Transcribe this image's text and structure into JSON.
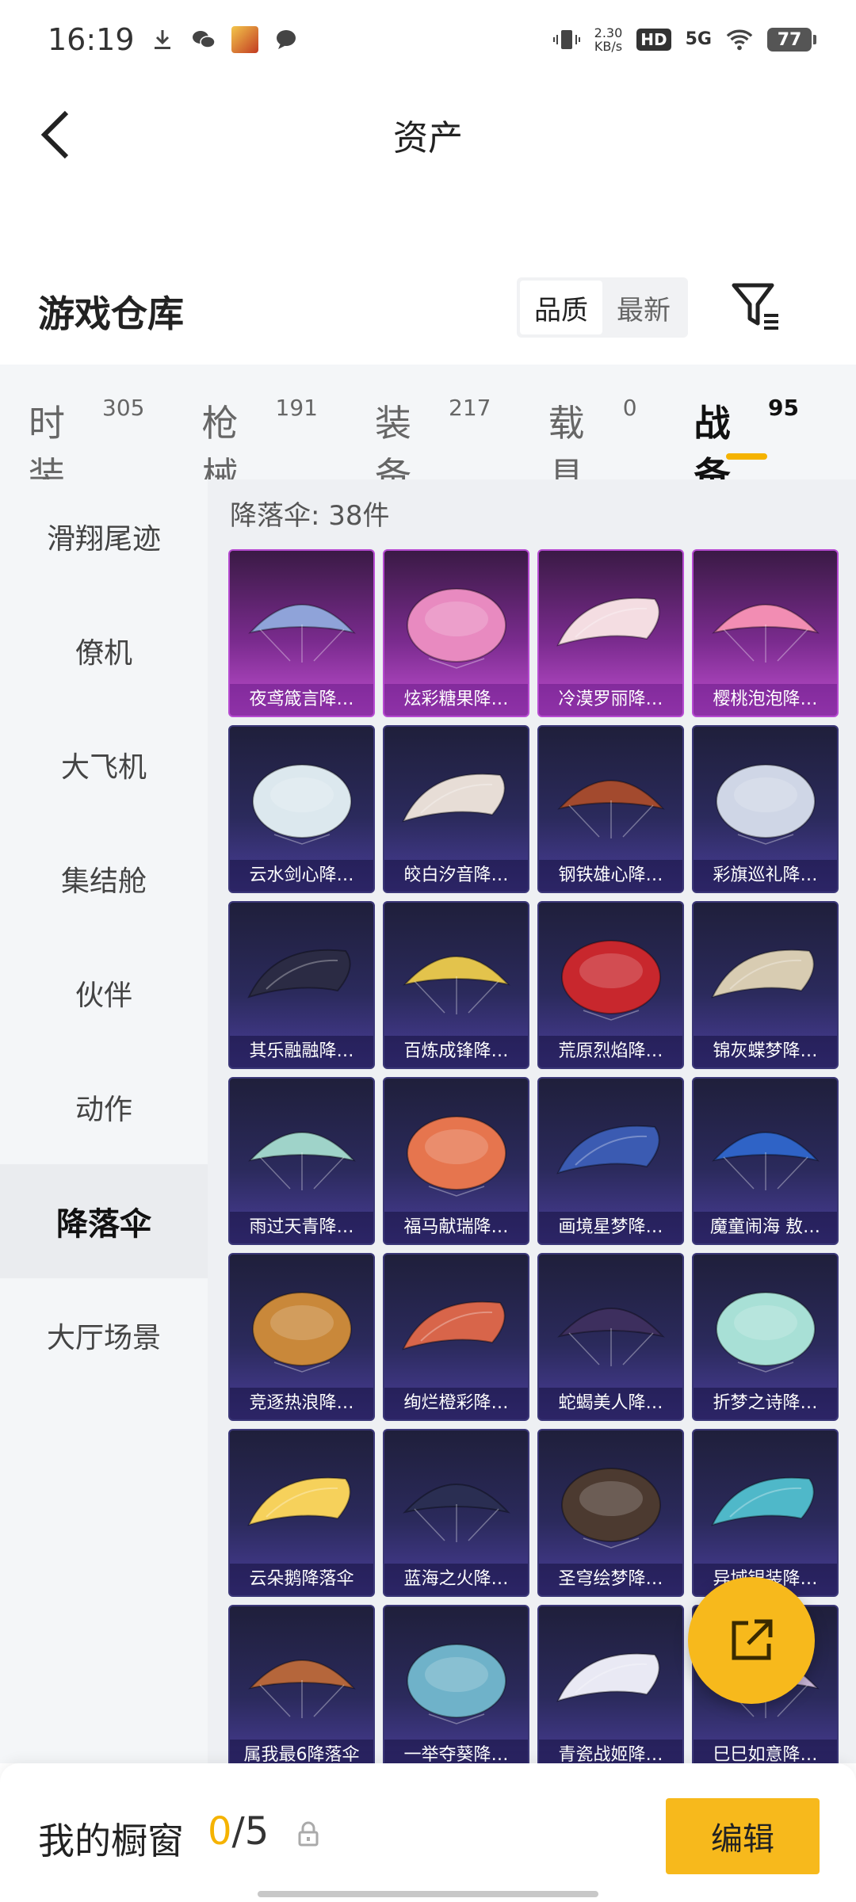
{
  "status_bar": {
    "time": "16:19",
    "net_speed_value": "2.30",
    "net_speed_unit": "KB/s",
    "hd_badge": "HD",
    "network": "5G",
    "battery": "77"
  },
  "header": {
    "title": "资产"
  },
  "warehouse": {
    "title": "游戏仓库",
    "sort_options": [
      "品质",
      "最新"
    ],
    "sort_active": "品质"
  },
  "tabs": [
    {
      "label": "时装",
      "count": "305"
    },
    {
      "label": "枪械",
      "count": "191"
    },
    {
      "label": "装备",
      "count": "217"
    },
    {
      "label": "载具",
      "count": "0"
    },
    {
      "label": "战备",
      "count": "95"
    }
  ],
  "side_nav": [
    {
      "label": "滑翔尾迹"
    },
    {
      "label": "僚机"
    },
    {
      "label": "大飞机"
    },
    {
      "label": "集结舱"
    },
    {
      "label": "伙伴"
    },
    {
      "label": "动作"
    },
    {
      "label": "降落伞"
    },
    {
      "label": "大厅场景"
    }
  ],
  "content": {
    "count_label": "降落伞: 38件",
    "items": [
      {
        "name": "夜鸢箴言降…",
        "rarity": "legend",
        "color": "#8fa3d9"
      },
      {
        "name": "炫彩糖果降…",
        "rarity": "legend",
        "color": "#e88ac0"
      },
      {
        "name": "冷漠罗丽降…",
        "rarity": "legend",
        "color": "#f4dde2"
      },
      {
        "name": "樱桃泡泡降…",
        "rarity": "legend",
        "color": "#f28db3"
      },
      {
        "name": "云水剑心降…",
        "rarity": "epic",
        "color": "#dce8ee"
      },
      {
        "name": "皎白汐音降…",
        "rarity": "epic",
        "color": "#e7ddd6"
      },
      {
        "name": "钢铁雄心降…",
        "rarity": "epic",
        "color": "#a34a2e"
      },
      {
        "name": "彩旗巡礼降…",
        "rarity": "epic",
        "color": "#cfd6e6"
      },
      {
        "name": "其乐融融降…",
        "rarity": "epic",
        "color": "#2b2b44"
      },
      {
        "name": "百炼成锋降…",
        "rarity": "epic",
        "color": "#e3c34c"
      },
      {
        "name": "荒原烈焰降…",
        "rarity": "epic",
        "color": "#c8272d"
      },
      {
        "name": "锦灰蝶梦降…",
        "rarity": "epic",
        "color": "#d8ccb2"
      },
      {
        "name": "雨过天青降…",
        "rarity": "epic",
        "color": "#9fd3c9"
      },
      {
        "name": "福马献瑞降…",
        "rarity": "epic",
        "color": "#e6754e"
      },
      {
        "name": "画境星梦降…",
        "rarity": "epic",
        "color": "#3b5bb2"
      },
      {
        "name": "魔童闹海 敖…",
        "rarity": "epic",
        "color": "#2f63c6"
      },
      {
        "name": "竞逐热浪降…",
        "rarity": "epic",
        "color": "#c9883a"
      },
      {
        "name": "绚烂橙彩降…",
        "rarity": "epic",
        "color": "#d8654a"
      },
      {
        "name": "蛇蝎美人降…",
        "rarity": "epic",
        "color": "#3d2f5e"
      },
      {
        "name": "折梦之诗降…",
        "rarity": "epic",
        "color": "#a8e0d6"
      },
      {
        "name": "云朵鹅降落伞",
        "rarity": "epic",
        "color": "#f6d15b"
      },
      {
        "name": "蓝海之火降…",
        "rarity": "epic",
        "color": "#2a2e52"
      },
      {
        "name": "圣穹绘梦降…",
        "rarity": "epic",
        "color": "#4c3a30"
      },
      {
        "name": "异域银装降…",
        "rarity": "epic",
        "color": "#4fb8c9"
      },
      {
        "name": "属我最6降落伞",
        "rarity": "epic",
        "color": "#b5663b"
      },
      {
        "name": "一举夺葵降…",
        "rarity": "epic",
        "color": "#6fb2c9"
      },
      {
        "name": "青瓷战姬降…",
        "rarity": "epic",
        "color": "#e9e9f4"
      },
      {
        "name": "巳巳如意降…",
        "rarity": "epic",
        "color": "#cdb9dc"
      }
    ]
  },
  "bottom_bar": {
    "window_label": "我的橱窗",
    "current": "0",
    "separator_total": "/5",
    "edit_label": "编辑"
  },
  "colors": {
    "accent": "#f7b91c",
    "legend_card": "#b64bd1",
    "epic_card": "#3b3778"
  }
}
